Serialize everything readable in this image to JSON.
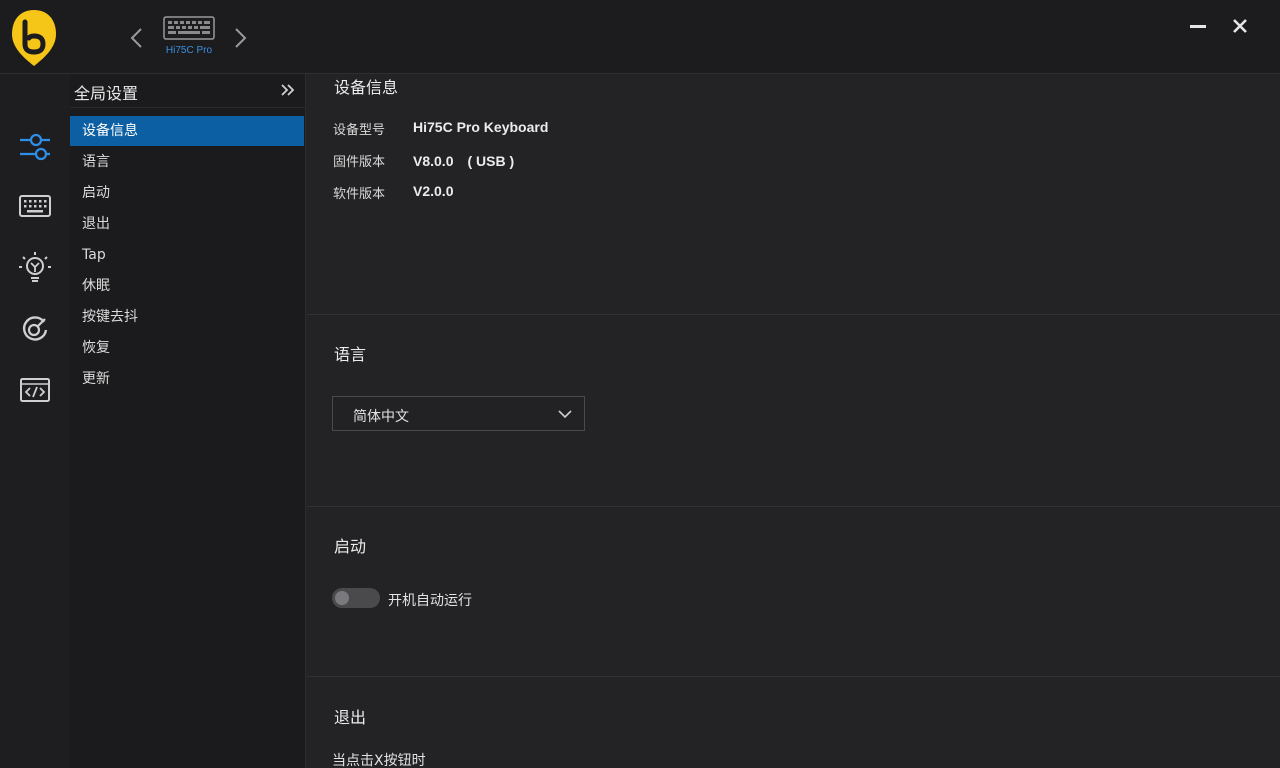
{
  "titlebar": {
    "device_name": "Hi75C Pro",
    "brand_color": "#f5c518",
    "accent_color": "#3a8fe0"
  },
  "rail": {
    "items": [
      {
        "icon": "sliders-icon",
        "active": true
      },
      {
        "icon": "keyboard-icon",
        "active": false
      },
      {
        "icon": "lightbulb-icon",
        "active": false
      },
      {
        "icon": "macro-target-icon",
        "active": false
      },
      {
        "icon": "code-icon",
        "active": false
      }
    ]
  },
  "nav": {
    "title": "全局设置",
    "items": [
      {
        "label": "设备信息",
        "active": true
      },
      {
        "label": "语言"
      },
      {
        "label": "启动"
      },
      {
        "label": "退出"
      },
      {
        "label": "Tap"
      },
      {
        "label": "休眠"
      },
      {
        "label": "按键去抖"
      },
      {
        "label": "恢复"
      },
      {
        "label": "更新"
      }
    ]
  },
  "device_info": {
    "title": "设备信息",
    "model_label": "设备型号",
    "model_value": "Hi75C Pro Keyboard",
    "firmware_label": "固件版本",
    "firmware_value": "V8.0.0　( USB )",
    "software_label": "软件版本",
    "software_value": "V2.0.0"
  },
  "language": {
    "title": "语言",
    "selected": "简体中文"
  },
  "startup": {
    "title": "启动",
    "autostart_label": "开机自动运行",
    "autostart_enabled": false
  },
  "exit": {
    "title": "退出",
    "hint": "当点击X按钮时"
  }
}
